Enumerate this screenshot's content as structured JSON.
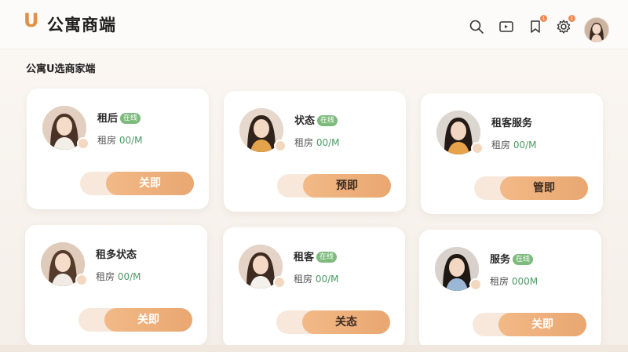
{
  "header": {
    "logo": "U",
    "title": "公寓商端",
    "icons": [
      {
        "name": "search-icon"
      },
      {
        "name": "video-icon"
      },
      {
        "name": "bookmark-icon",
        "badge": "1"
      },
      {
        "name": "settings-gear-icon",
        "badge": "1"
      }
    ]
  },
  "section": {
    "title": "公寓U选商家端"
  },
  "cards": [
    {
      "name": "租后",
      "tag": "在线",
      "price_label": "租房",
      "price_value": "00/M",
      "button": "关即"
    },
    {
      "name": "状态",
      "tag": "在线",
      "price_label": "租房",
      "price_value": "00/M",
      "button": "预即"
    },
    {
      "name": "租客服务",
      "tag": "",
      "price_label": "租房",
      "price_value": "00/M",
      "button": "管即"
    },
    {
      "name": "租多状态",
      "tag": "",
      "price_label": "租房",
      "price_value": "00/M",
      "button": "关即"
    },
    {
      "name": "租客",
      "tag": "在线",
      "price_label": "租房",
      "price_value": "00/M",
      "button": "关态"
    },
    {
      "name": "服务",
      "tag": "在线",
      "price_label": "租房",
      "price_value": "000M",
      "button": "关即"
    }
  ],
  "colors": {
    "accent": "#e9a771",
    "tag_green": "#7dbb7d",
    "price_green": "#4c9a63",
    "logo": "#e0904a"
  }
}
